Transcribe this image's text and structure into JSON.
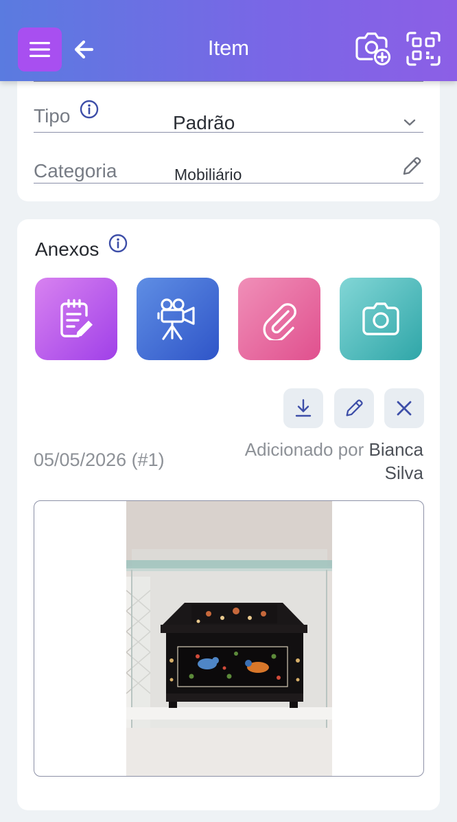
{
  "header": {
    "title": "Item"
  },
  "form": {
    "tipo": {
      "label": "Tipo",
      "value": "Padrão"
    },
    "categoria": {
      "label": "Categoria",
      "value": "Mobiliário"
    }
  },
  "attachments": {
    "title": "Anexos",
    "tiles": [
      "note-icon",
      "video-camera-icon",
      "paperclip-icon",
      "camera-icon"
    ],
    "date": "05/05/2026 (#1)",
    "added_by_prefix": "Adicionado por",
    "added_by_name": "Bianca Silva"
  },
  "colors": {
    "header_start": "#5a7be0",
    "header_end": "#8c5fe6",
    "menu_button": "#a84ff0",
    "note_tile": "#a040e8",
    "video_tile": "#2f55c8",
    "clip_tile": "#e0508e",
    "camera_tile": "#2fa6a8",
    "accent_icon": "#3d4ea8"
  }
}
